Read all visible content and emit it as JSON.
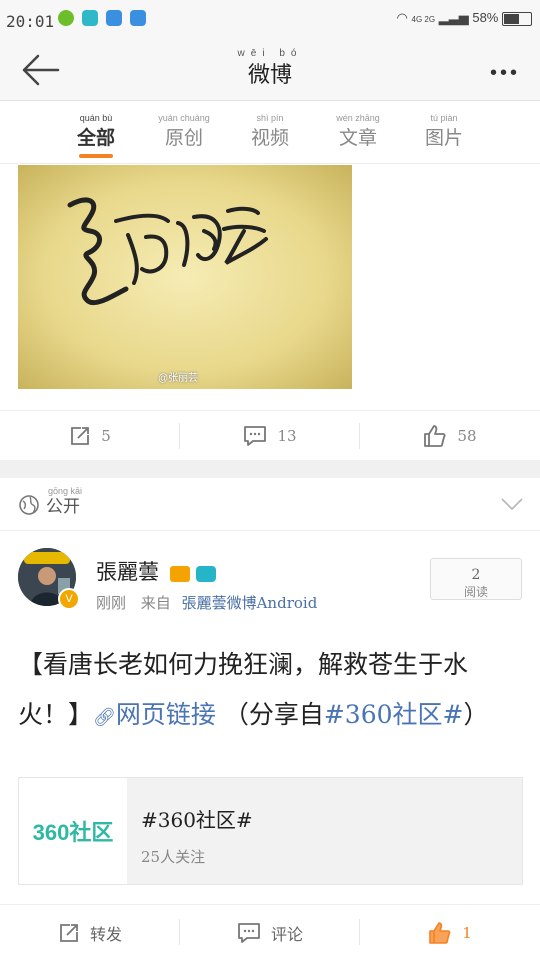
{
  "status_bar": {
    "time": "20:01",
    "network": "4G 2G",
    "battery": "58%",
    "app_icons": [
      "add-circle-icon",
      "scan-icon",
      "weather-icon",
      "weather-icon"
    ]
  },
  "header": {
    "title": "微博",
    "title_pinyin": "wēi bó"
  },
  "tabs": [
    {
      "label": "全部",
      "pinyin": "quán bù",
      "active": true
    },
    {
      "label": "原创",
      "pinyin": "yuán chuàng",
      "active": false
    },
    {
      "label": "视频",
      "pinyin": "shì pín",
      "active": false
    },
    {
      "label": "文章",
      "pinyin": "wén zhāng",
      "active": false
    },
    {
      "label": "图片",
      "pinyin": "tú piàn",
      "active": false
    }
  ],
  "prev_post": {
    "image_watermark": "@张丽芸",
    "repost_count": "5",
    "comment_count": "13",
    "like_count": "58"
  },
  "post": {
    "privacy_label": "公开",
    "privacy_pinyin": "gōng kāi",
    "username": "張麗蕓",
    "time": "刚刚",
    "from_label": "来自",
    "source": "張麗蕓微博Android",
    "read_count": "2",
    "read_label": "阅读",
    "text_prefix": "【看唐长老如何力挽狂澜，解救苍生于水火！】",
    "link_text": "网页链接",
    "text_share": "（分享自",
    "hashtag": "#360社区#",
    "text_suffix": "）",
    "card": {
      "logo_text": "360社区",
      "title": "#360社区#",
      "followers": "25人关注"
    }
  },
  "actions": {
    "repost_label": "转发",
    "comment_label": "评论",
    "like_count": "1"
  },
  "colors": {
    "accent_orange": "#f58220",
    "link_blue": "#4a74b5",
    "logo_teal": "#2fb8a4"
  }
}
